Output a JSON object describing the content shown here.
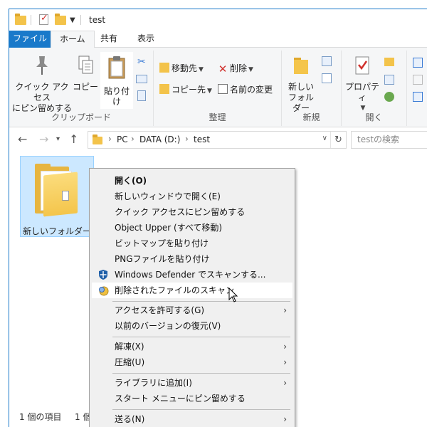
{
  "window": {
    "title": "test"
  },
  "tabs": {
    "file": "ファイル",
    "home": "ホーム",
    "share": "共有",
    "view": "表示"
  },
  "ribbon": {
    "clipboard": {
      "label": "クリップボード",
      "pin": "クイック アクセス\nにピン留めする",
      "copy": "コピー",
      "paste": "貼り付け"
    },
    "organize": {
      "label": "整理",
      "move_to": "移動先",
      "copy_to": "コピー先",
      "delete": "削除",
      "rename": "名前の変更"
    },
    "new": {
      "label": "新規",
      "new_folder": "新しい\nフォルダー"
    },
    "open": {
      "label": "開く",
      "properties": "プロパティ"
    }
  },
  "address": {
    "pc": "PC",
    "drive": "DATA (D:)",
    "folder": "test",
    "search_placeholder": "testの検索"
  },
  "items": [
    {
      "label": "新しいフォルダー"
    }
  ],
  "status": {
    "count": "1 個の項目",
    "selected": "1 個"
  },
  "context_menu": {
    "items": [
      {
        "label": "開く(O)"
      },
      {
        "label": "新しいウィンドウで開く(E)"
      },
      {
        "label": "クイック アクセスにピン留めする"
      },
      {
        "label": "Object Upper (すべて移動)"
      },
      {
        "label": "ビットマップを貼り付け"
      },
      {
        "label": "PNGファイルを貼り付け"
      },
      {
        "label": "Windows Defender でスキャンする..."
      },
      {
        "label": "削除されたファイルのスキャン"
      },
      {
        "label": "アクセスを許可する(G)"
      },
      {
        "label": "以前のバージョンの復元(V)"
      },
      {
        "label": "解凍(X)"
      },
      {
        "label": "圧縮(U)"
      },
      {
        "label": "ライブラリに追加(I)"
      },
      {
        "label": "スタート メニューにピン留めする"
      },
      {
        "label": "送る(N)"
      }
    ]
  },
  "colors": {
    "accent": "#1979ca",
    "selection": "#cce8ff",
    "folder": "#f4c54b"
  }
}
